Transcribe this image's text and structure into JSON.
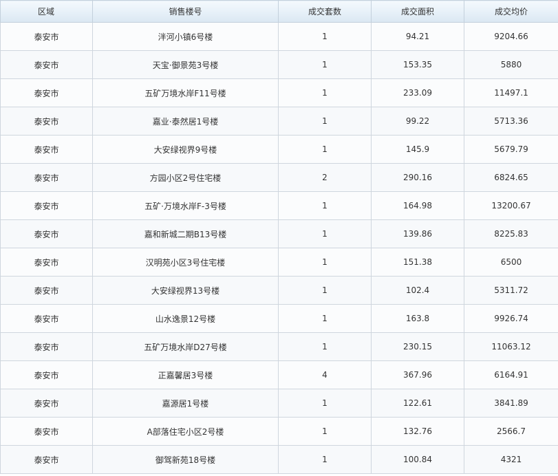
{
  "table": {
    "headers": [
      "区域",
      "销售楼号",
      "成交套数",
      "成交面积",
      "成交均价"
    ],
    "rows": [
      [
        "泰安市",
        "泮河小镇6号楼",
        "1",
        "94.21",
        "9204.66"
      ],
      [
        "泰安市",
        "天宝·御景苑3号楼",
        "1",
        "153.35",
        "5880"
      ],
      [
        "泰安市",
        "五矿万境水岸F11号楼",
        "1",
        "233.09",
        "11497.1"
      ],
      [
        "泰安市",
        "嘉业·泰然居1号楼",
        "1",
        "99.22",
        "5713.36"
      ],
      [
        "泰安市",
        "大安绿视界9号楼",
        "1",
        "145.9",
        "5679.79"
      ],
      [
        "泰安市",
        "方园小区2号住宅楼",
        "2",
        "290.16",
        "6824.65"
      ],
      [
        "泰安市",
        "五矿·万境水岸F-3号楼",
        "1",
        "164.98",
        "13200.67"
      ],
      [
        "泰安市",
        "嘉和新城二期B13号楼",
        "1",
        "139.86",
        "8225.83"
      ],
      [
        "泰安市",
        "汉明苑小区3号住宅楼",
        "1",
        "151.38",
        "6500"
      ],
      [
        "泰安市",
        "大安绿视界13号楼",
        "1",
        "102.4",
        "5311.72"
      ],
      [
        "泰安市",
        "山水逸景12号楼",
        "1",
        "163.8",
        "9926.74"
      ],
      [
        "泰安市",
        "五矿万境水岸D27号楼",
        "1",
        "230.15",
        "11063.12"
      ],
      [
        "泰安市",
        "正嘉馨居3号楼",
        "4",
        "367.96",
        "6164.91"
      ],
      [
        "泰安市",
        "嘉源居1号楼",
        "1",
        "122.61",
        "3841.89"
      ],
      [
        "泰安市",
        "A部落住宅小区2号楼",
        "1",
        "132.76",
        "2566.7"
      ],
      [
        "泰安市",
        "御驾新苑18号楼",
        "1",
        "100.84",
        "4321"
      ]
    ]
  }
}
